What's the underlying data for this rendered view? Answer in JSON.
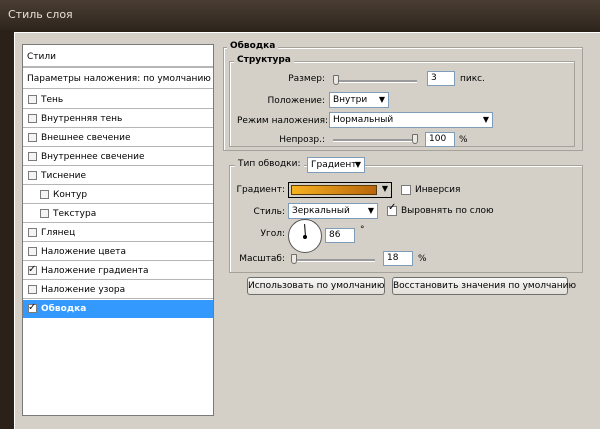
{
  "window": {
    "title": "Стиль слоя"
  },
  "styles_list": {
    "header": "Стили",
    "blending_options": "Параметры наложения: по умолчанию",
    "items": [
      {
        "label": "Тень",
        "checked": false
      },
      {
        "label": "Внутренняя тень",
        "checked": false
      },
      {
        "label": "Внешнее свечение",
        "checked": false
      },
      {
        "label": "Внутреннее свечение",
        "checked": false
      },
      {
        "label": "Тиснение",
        "checked": false
      },
      {
        "label": "Контур",
        "checked": false
      },
      {
        "label": "Текстура",
        "checked": false
      },
      {
        "label": "Глянец",
        "checked": false
      },
      {
        "label": "Наложение цвета",
        "checked": false
      },
      {
        "label": "Наложение градиента",
        "checked": true
      },
      {
        "label": "Наложение узора",
        "checked": false
      },
      {
        "label": "Обводка",
        "checked": true,
        "selected": true
      }
    ]
  },
  "stroke": {
    "title": "Обводка",
    "structure": {
      "title": "Структура",
      "size_label": "Размер:",
      "size_value": "3",
      "size_unit": "пикс.",
      "size_slider_fraction": 0.03,
      "position_label": "Положение:",
      "position_value": "Внутри",
      "blend_mode_label": "Режим наложения:",
      "blend_mode_value": "Нормальный",
      "opacity_label": "Непрозр.:",
      "opacity_value": "100",
      "opacity_unit": "%",
      "opacity_slider_fraction": 1.0
    },
    "fill": {
      "fill_type_label": "Тип обводки:",
      "fill_type_value": "Градиент",
      "gradient_label": "Градиент:",
      "gradient_colors": [
        "#f7b221",
        "#b8650a"
      ],
      "reverse_label": "Инверсия",
      "reverse_checked": false,
      "style_label": "Стиль:",
      "style_value": "Зеркальный",
      "align_label": "Выровнять по слою",
      "align_checked": true,
      "angle_label": "Угол:",
      "angle_value": "86",
      "angle_unit": "°",
      "scale_label": "Масштаб:",
      "scale_value": "18",
      "scale_unit": "%",
      "scale_slider_fraction": 0.01
    },
    "buttons": {
      "make_default": "Использовать по умолчанию",
      "reset_default": "Восстановить значения по умолчанию"
    }
  }
}
